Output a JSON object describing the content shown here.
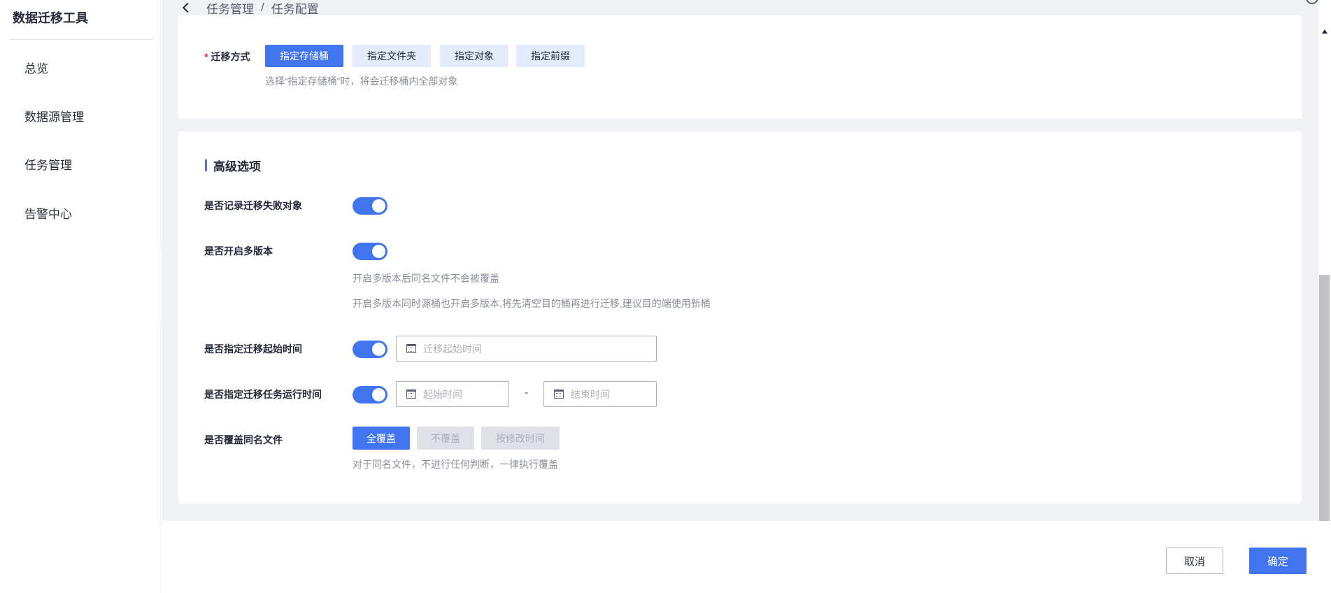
{
  "sidebar": {
    "app_title": "数据迁移工具",
    "items": [
      {
        "label": "总览"
      },
      {
        "label": "数据源管理"
      },
      {
        "label": "任务管理"
      },
      {
        "label": "告警中心"
      }
    ]
  },
  "breadcrumb": {
    "parent": "任务管理",
    "separator": "/",
    "current": "任务配置"
  },
  "migration": {
    "label": "迁移方式",
    "options": [
      "指定存储桶",
      "指定文件夹",
      "指定对象",
      "指定前缀"
    ],
    "selected": "指定存储桶",
    "hint": "选择“指定存储桶”时，将会迁移桶内全部对象"
  },
  "advanced": {
    "title": "高级选项",
    "record_failed": {
      "label": "是否记录迁移失败对象",
      "enabled": true
    },
    "multi_version": {
      "label": "是否开启多版本",
      "enabled": true,
      "hint1": "开启多版本后同名文件不会被覆盖",
      "hint2": "开启多版本同时源桶也开启多版本,将先清空目的桶再进行迁移,建议目的端使用新桶"
    },
    "start_time": {
      "label": "是否指定迁移起始时间",
      "enabled": true,
      "placeholder": "迁移起始时间"
    },
    "run_time": {
      "label": "是否指定迁移任务运行时间",
      "enabled": true,
      "start_placeholder": "起始时间",
      "dash": "-",
      "end_placeholder": "结束时间"
    },
    "overwrite": {
      "label": "是否覆盖同名文件",
      "options": [
        "全覆盖",
        "不覆盖",
        "按修改时间"
      ],
      "selected": "全覆盖",
      "hint": "对于同名文件，不进行任何判断，一律执行覆盖"
    }
  },
  "footer": {
    "cancel": "取消",
    "confirm": "确定"
  },
  "colors": {
    "primary": "#4175f0",
    "required": "#f5222d"
  }
}
